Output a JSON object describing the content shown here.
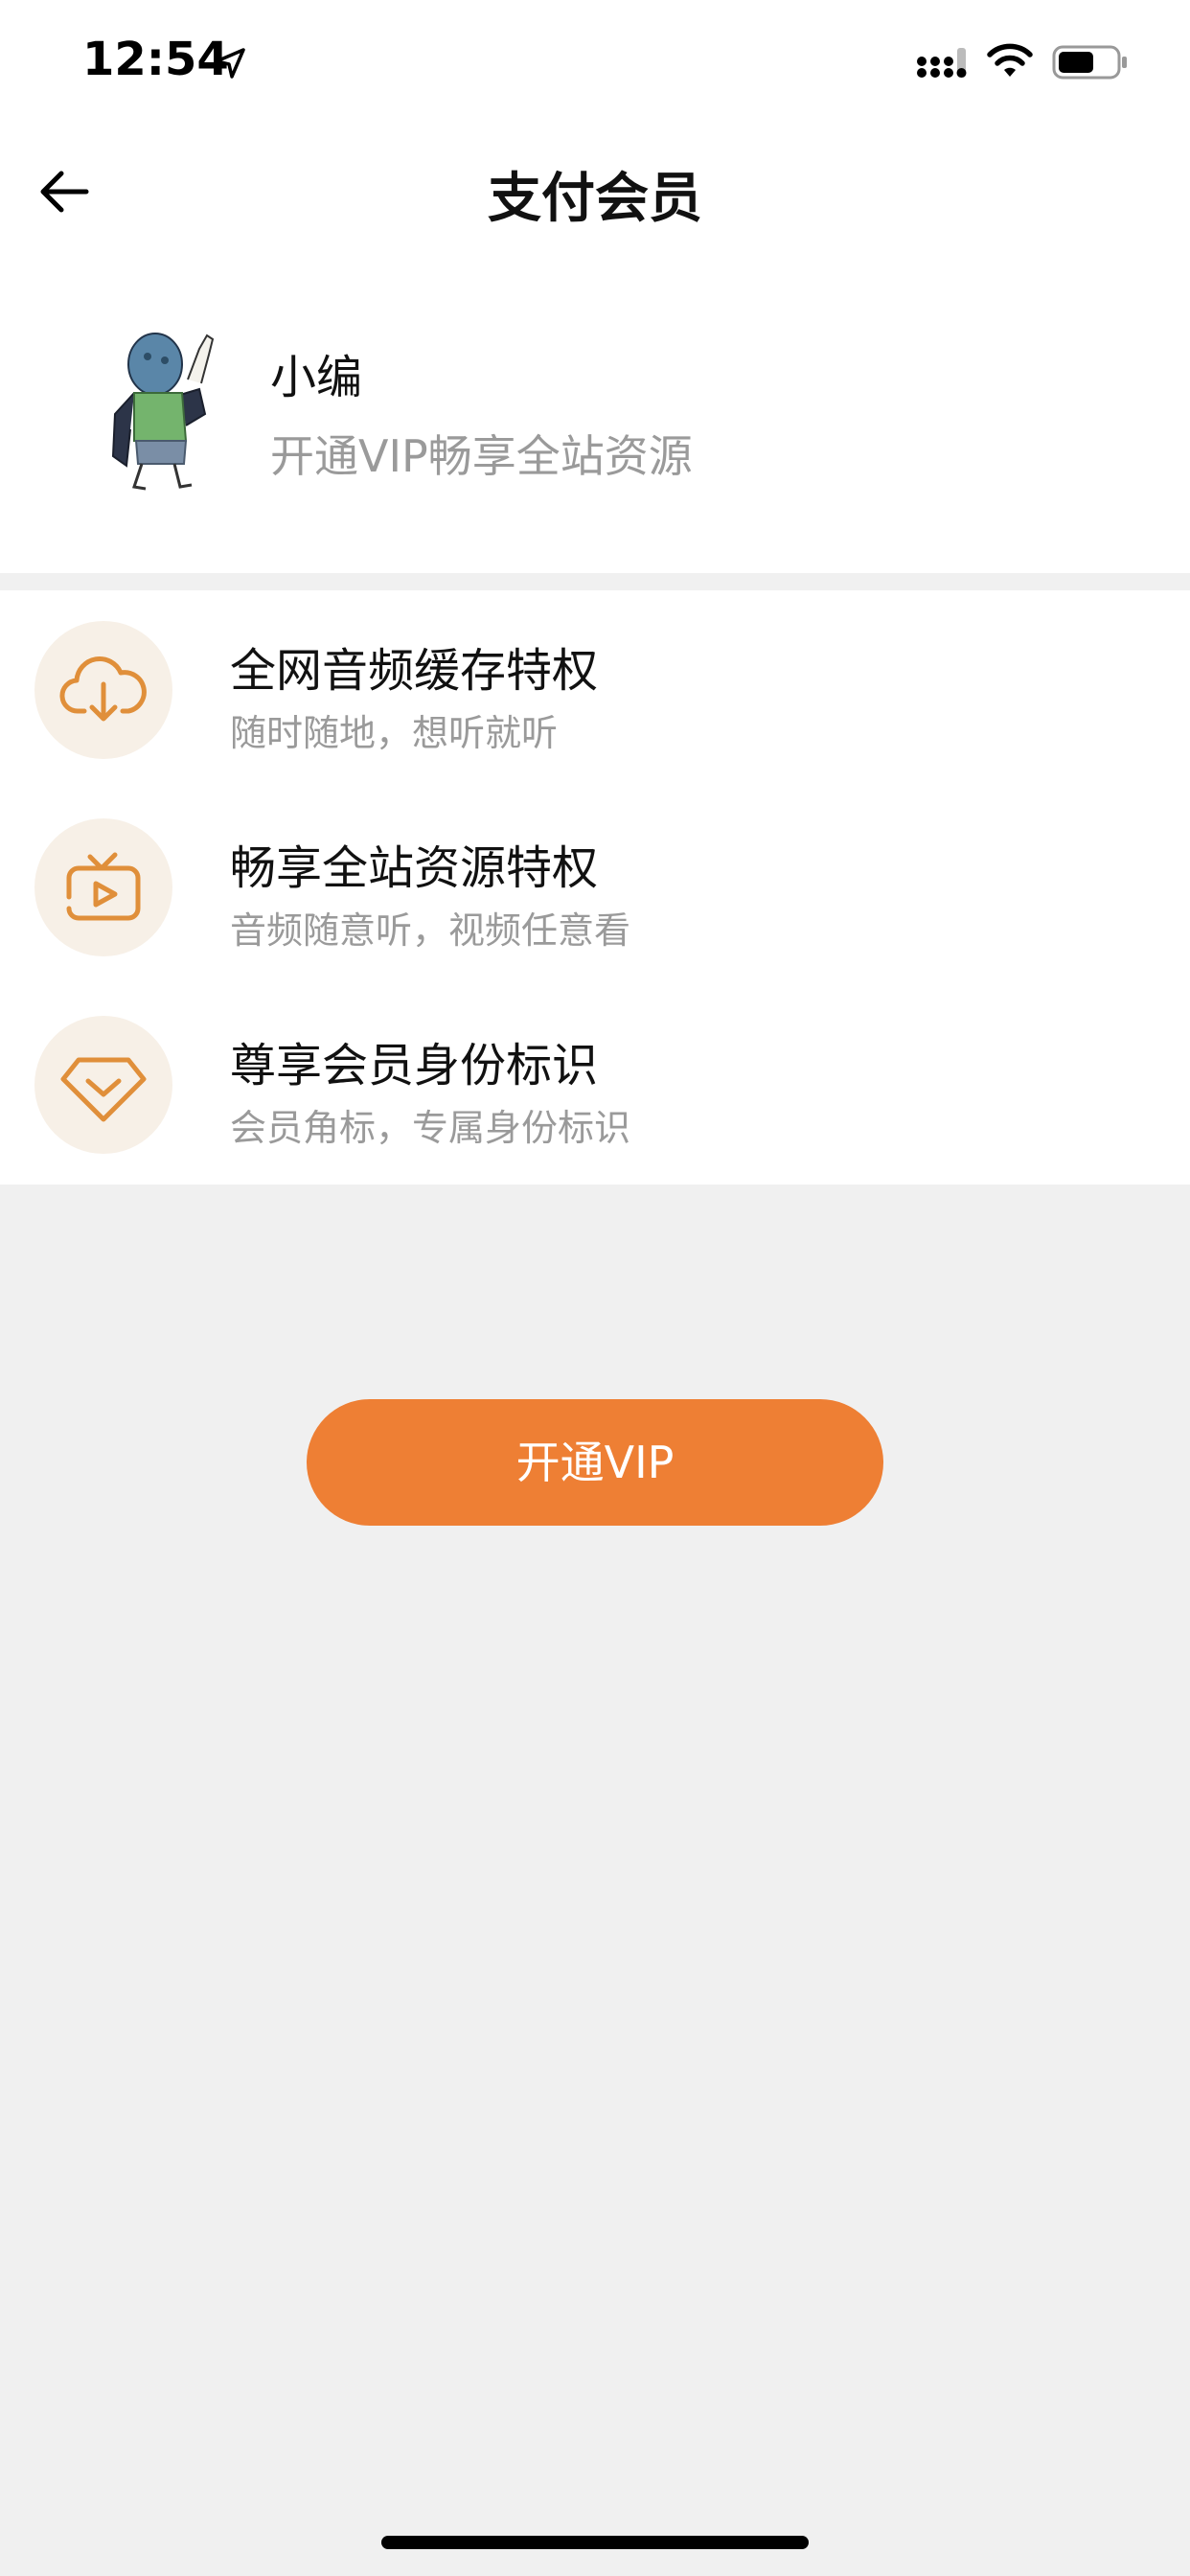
{
  "status_bar": {
    "time": "12:54",
    "location_icon": "location-arrow-icon",
    "signal_icon": "cellular-signal-icon",
    "wifi_icon": "wifi-icon",
    "battery_icon": "battery-icon",
    "battery_level": 0.6
  },
  "nav": {
    "back_icon": "back-arrow-icon",
    "title": "支付会员"
  },
  "profile": {
    "avatar_icon": "user-avatar",
    "name": "小编",
    "subtitle": "开通VIP畅享全站资源"
  },
  "benefits": [
    {
      "icon": "cloud-download-icon",
      "title": "全网音频缓存特权",
      "desc": "随时随地，想听就听"
    },
    {
      "icon": "tv-play-icon",
      "title": "畅享全站资源特权",
      "desc": "音频随意听，视频任意看"
    },
    {
      "icon": "diamond-icon",
      "title": "尊享会员身份标识",
      "desc": "会员角标，专属身份标识"
    }
  ],
  "cta": {
    "label": "开通VIP"
  },
  "colors": {
    "accent": "#ee7f34",
    "icon_stroke": "#e08f3a",
    "icon_bg": "#f7f0e7",
    "page_bg": "#f0f0f0",
    "secondary_text": "#9a9a9a"
  }
}
